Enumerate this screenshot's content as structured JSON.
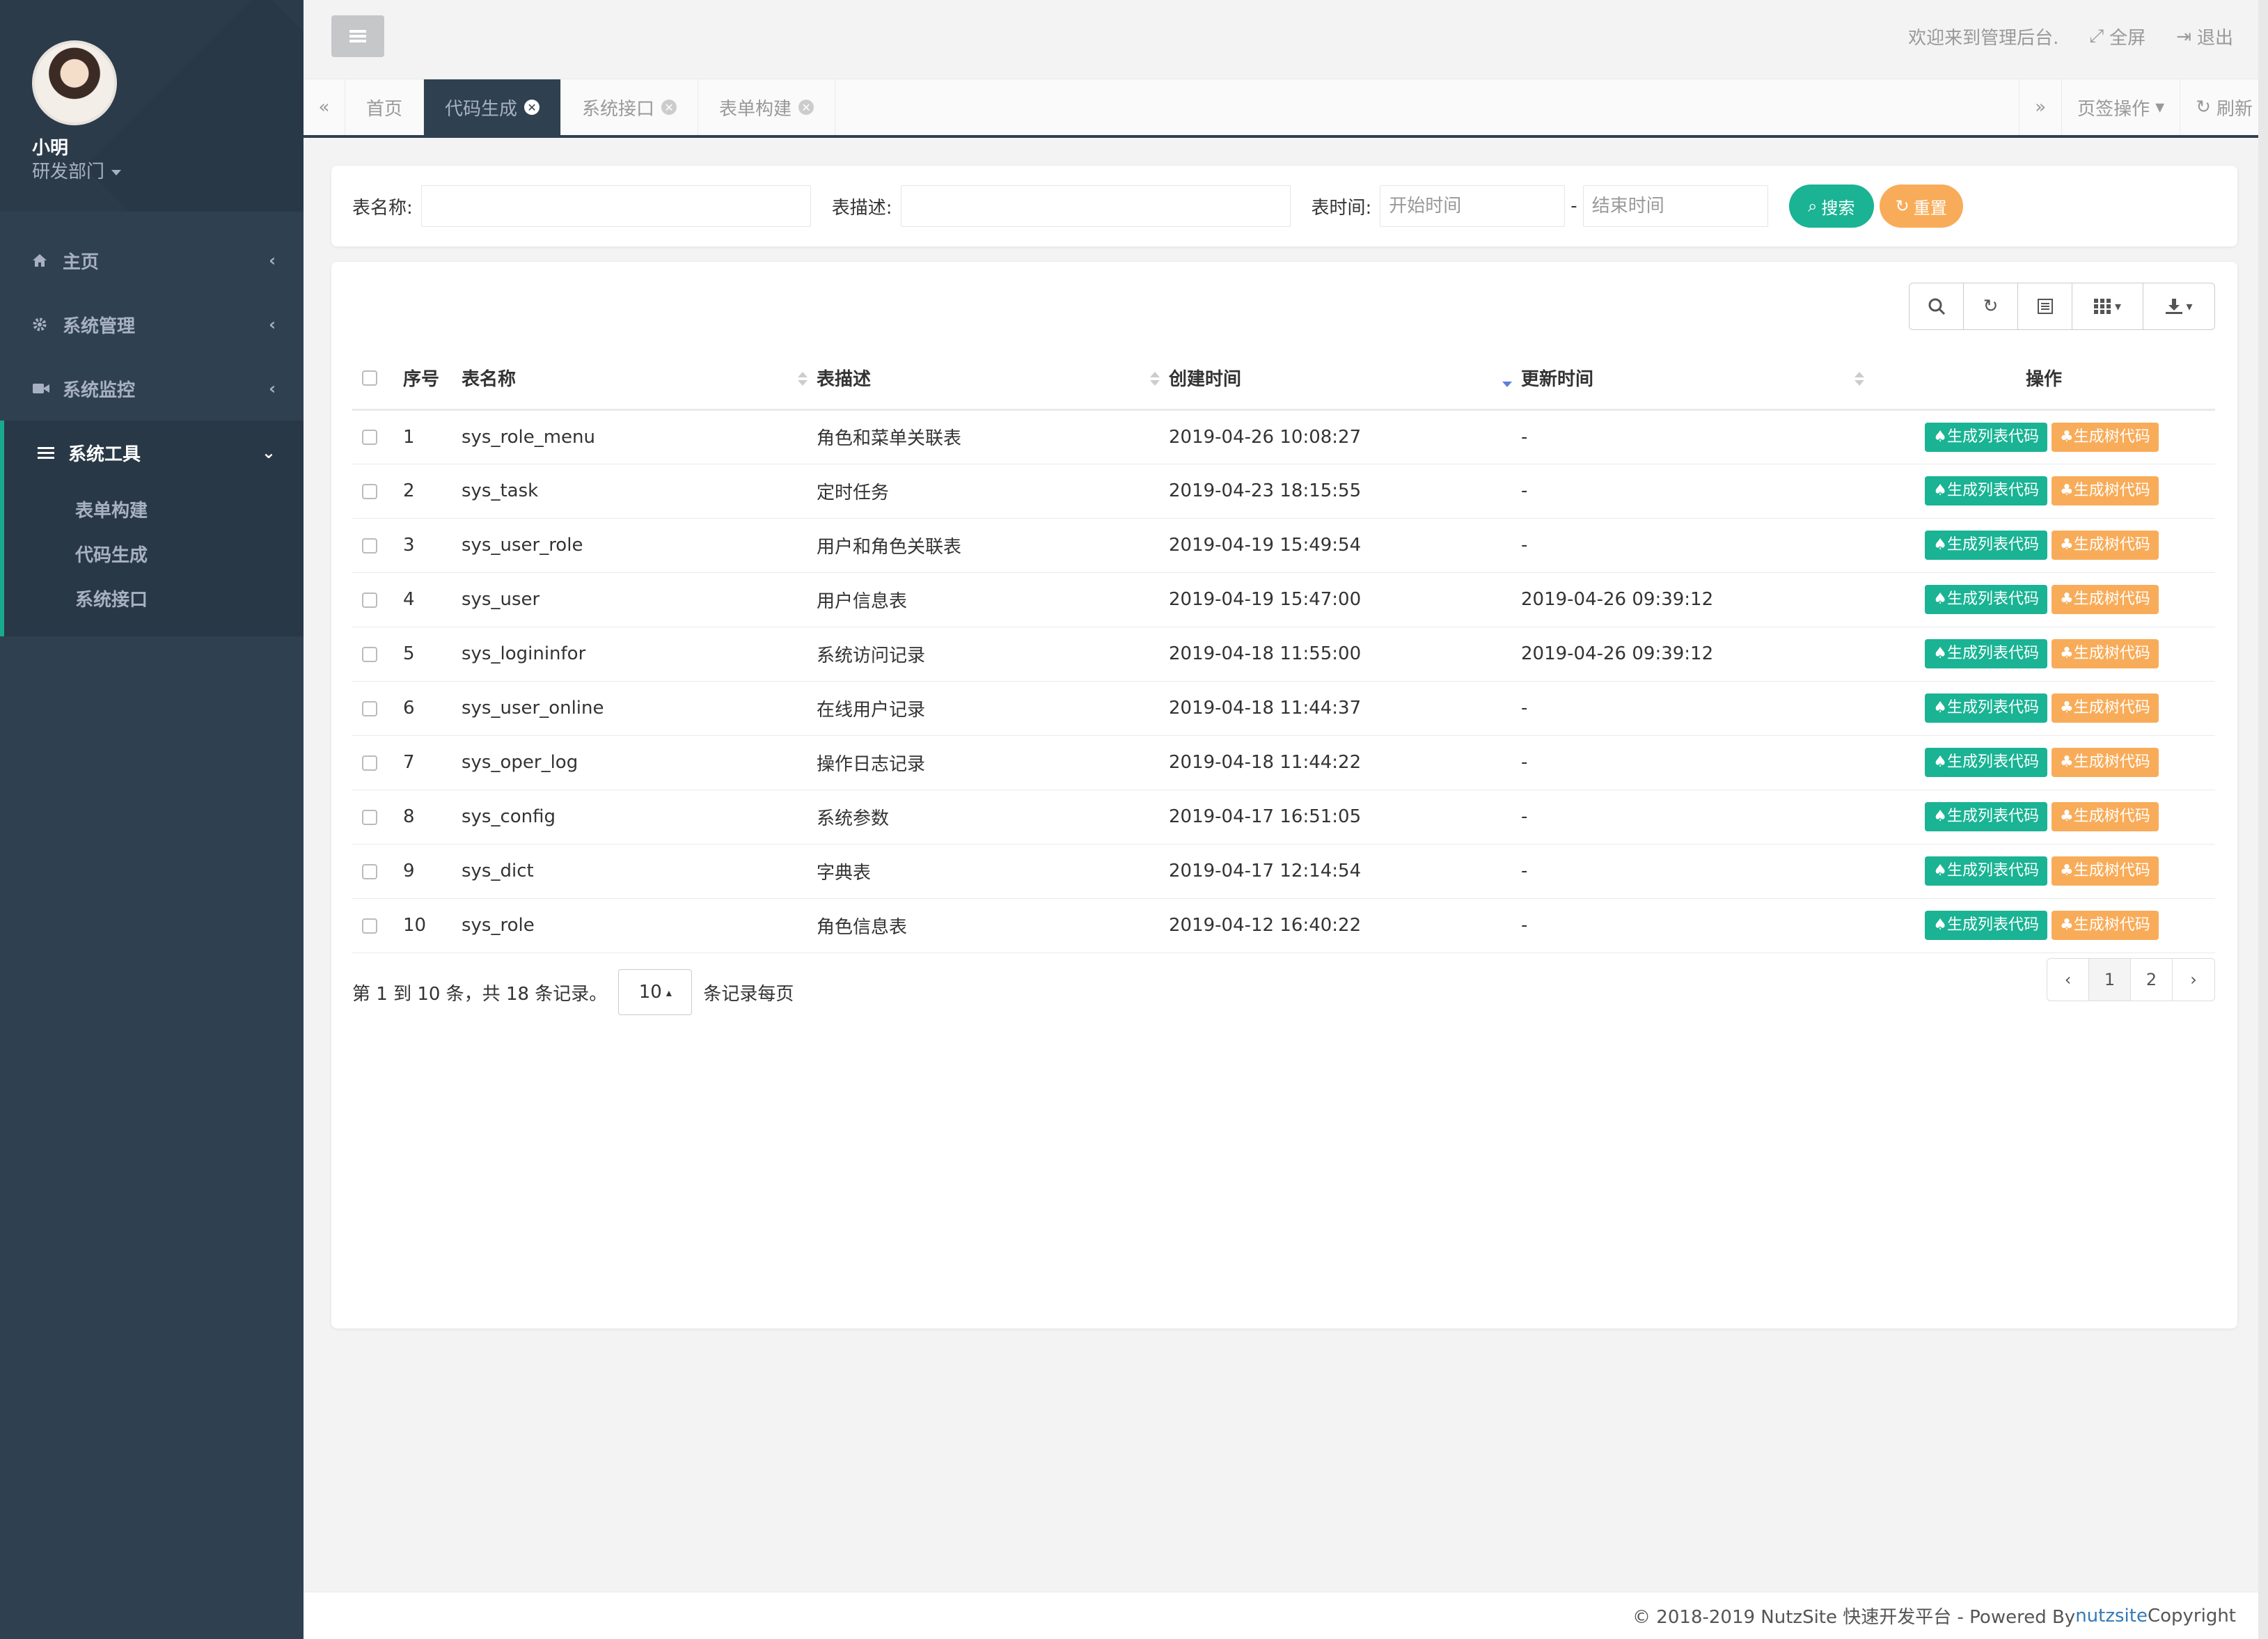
{
  "sidebar": {
    "user_name": "小明",
    "user_dept": "研发部门",
    "nav": [
      {
        "label": "主页",
        "icon": "home-icon"
      },
      {
        "label": "系统管理",
        "icon": "gear-icon"
      },
      {
        "label": "系统监控",
        "icon": "video-icon"
      },
      {
        "label": "系统工具",
        "icon": "list-icon",
        "active": true
      }
    ],
    "sub_items": [
      "表单构建",
      "代码生成",
      "系统接口"
    ]
  },
  "header": {
    "welcome": "欢迎来到管理后台.",
    "fullscreen": "全屏",
    "logout": "退出"
  },
  "tabs": {
    "items": [
      {
        "label": "首页",
        "closable": false,
        "active": false
      },
      {
        "label": "代码生成",
        "closable": true,
        "active": true
      },
      {
        "label": "系统接口",
        "closable": true,
        "active": false
      },
      {
        "label": "表单构建",
        "closable": true,
        "active": false
      }
    ],
    "page_ops": "页签操作",
    "refresh": "刷新"
  },
  "search": {
    "table_name_label": "表名称:",
    "table_desc_label": "表描述:",
    "table_time_label": "表时间:",
    "start_placeholder": "开始时间",
    "end_placeholder": "结束时间",
    "range_sep": "-",
    "search_btn": "搜索",
    "reset_btn": "重置"
  },
  "colors": {
    "sidebar_bg": "#2f4050",
    "accent_green": "#1ab394",
    "accent_orange": "#f8ac59"
  },
  "table": {
    "headers": [
      "序号",
      "表名称",
      "表描述",
      "创建时间",
      "更新时间",
      "操作"
    ],
    "op_list_label": "生成列表代码",
    "op_tree_label": "生成树代码",
    "rows": [
      {
        "no": "1",
        "name": "sys_role_menu",
        "desc": "角色和菜单关联表",
        "created": "2019-04-26 10:08:27",
        "updated": "-"
      },
      {
        "no": "2",
        "name": "sys_task",
        "desc": "定时任务",
        "created": "2019-04-23 18:15:55",
        "updated": "-"
      },
      {
        "no": "3",
        "name": "sys_user_role",
        "desc": "用户和角色关联表",
        "created": "2019-04-19 15:49:54",
        "updated": "-"
      },
      {
        "no": "4",
        "name": "sys_user",
        "desc": "用户信息表",
        "created": "2019-04-19 15:47:00",
        "updated": "2019-04-26 09:39:12"
      },
      {
        "no": "5",
        "name": "sys_logininfor",
        "desc": "系统访问记录",
        "created": "2019-04-18 11:55:00",
        "updated": "2019-04-26 09:39:12"
      },
      {
        "no": "6",
        "name": "sys_user_online",
        "desc": "在线用户记录",
        "created": "2019-04-18 11:44:37",
        "updated": "-"
      },
      {
        "no": "7",
        "name": "sys_oper_log",
        "desc": "操作日志记录",
        "created": "2019-04-18 11:44:22",
        "updated": "-"
      },
      {
        "no": "8",
        "name": "sys_config",
        "desc": "系统参数",
        "created": "2019-04-17 16:51:05",
        "updated": "-"
      },
      {
        "no": "9",
        "name": "sys_dict",
        "desc": "字典表",
        "created": "2019-04-17 12:14:54",
        "updated": "-"
      },
      {
        "no": "10",
        "name": "sys_role",
        "desc": "角色信息表",
        "created": "2019-04-12 16:40:22",
        "updated": "-"
      }
    ]
  },
  "pager": {
    "summary": "第 1 到 10 条，共 18 条记录。",
    "page_size": "10",
    "per_page_label": "条记录每页",
    "pages": [
      "‹",
      "1",
      "2",
      "›"
    ],
    "current_page": "1"
  },
  "footer": {
    "text": "© 2018-2019 NutzSite 快速开发平台 - Powered By ",
    "link": "nutzsite",
    "suffix": " Copyright"
  }
}
